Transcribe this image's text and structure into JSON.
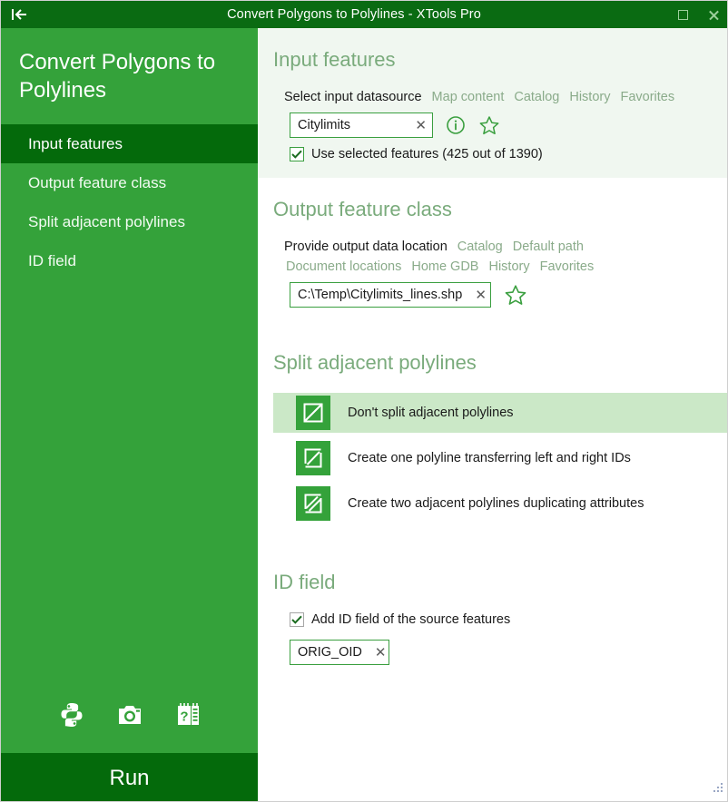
{
  "window": {
    "title": "Convert Polygons to Polylines - XTools Pro",
    "back_icon": "back-arrow-icon",
    "maximize_icon": "maximize-icon",
    "close_icon": "close-icon"
  },
  "sidebar": {
    "heading": "Convert Polygons to Polylines",
    "items": [
      {
        "label": "Input features",
        "active": true
      },
      {
        "label": "Output feature class",
        "active": false
      },
      {
        "label": "Split adjacent polylines",
        "active": false
      },
      {
        "label": "ID field",
        "active": false
      }
    ],
    "tool_icons": [
      {
        "name": "python-icon"
      },
      {
        "name": "camera-icon"
      },
      {
        "name": "help-book-icon"
      }
    ],
    "run_label": "Run"
  },
  "input_features": {
    "heading": "Input features",
    "prompt": "Select input datasource",
    "links": [
      "Map content",
      "Catalog",
      "History",
      "Favorites"
    ],
    "datasource_value": "Citylimits",
    "clear_glyph": "✕",
    "info_icon": "info-icon",
    "favorite_icon": "star-icon",
    "use_selected_checked": true,
    "use_selected_label": "Use selected features (425 out of 1390)"
  },
  "output_feature_class": {
    "heading": "Output feature class",
    "prompt": "Provide output data location",
    "links_row1": [
      "Catalog",
      "Default path"
    ],
    "links_row2": [
      "Document locations",
      "Home GDB",
      "History",
      "Favorites"
    ],
    "path_value": "C:\\Temp\\Citylimits_lines.shp",
    "clear_glyph": "✕",
    "favorite_icon": "star-icon"
  },
  "split_adjacent_polylines": {
    "heading": "Split adjacent polylines",
    "options": [
      {
        "label": "Don't split adjacent polylines",
        "icon": "no-split-square-icon",
        "selected": true
      },
      {
        "label": "Create one polyline transferring left and right IDs",
        "icon": "split-one-polyline-icon",
        "selected": false
      },
      {
        "label": "Create two adjacent polylines duplicating attributes",
        "icon": "split-two-polylines-icon",
        "selected": false
      }
    ]
  },
  "id_field": {
    "heading": "ID field",
    "add_id_checked": true,
    "add_id_label": "Add ID field of the source features",
    "field_value": "ORIG_OID",
    "clear_glyph": "✕"
  },
  "colors": {
    "titlebar": "#0a6b12",
    "sidebar": "#34a23a",
    "sidebar_active": "#046a0b",
    "section_tint": "#f0f7f0",
    "option_selected": "#cbe8c7",
    "heading_text": "#7aab7c",
    "link_text": "#8aab8a",
    "accent_green": "#3a9f3f"
  }
}
